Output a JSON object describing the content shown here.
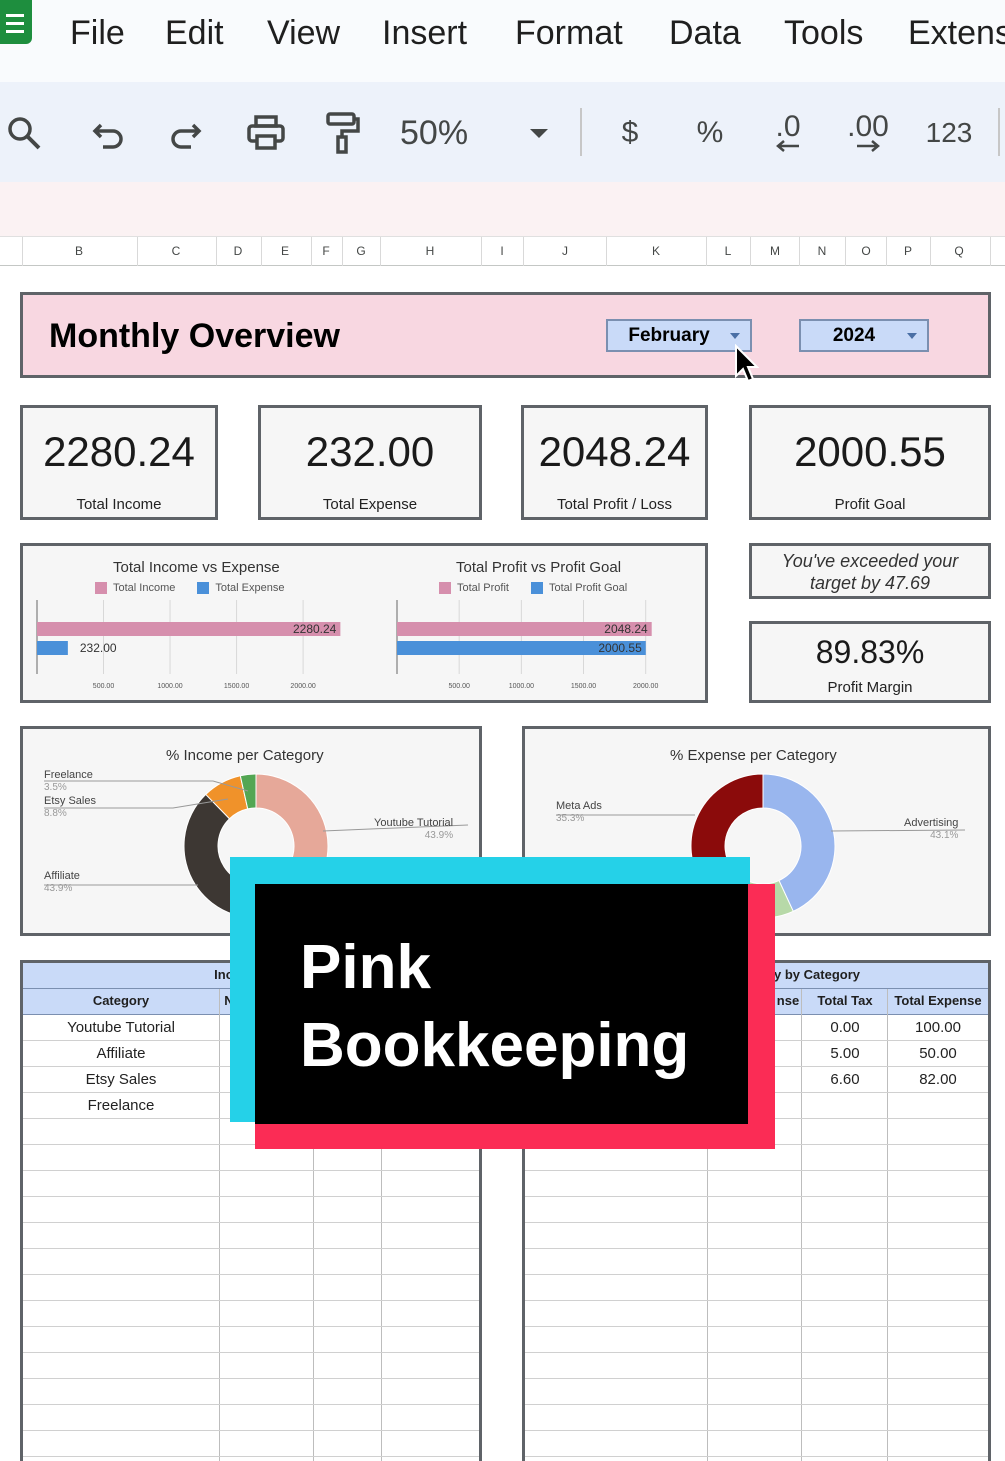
{
  "menu": {
    "items": [
      "File",
      "Edit",
      "View",
      "Insert",
      "Format",
      "Data",
      "Tools",
      "Extens"
    ]
  },
  "toolbar": {
    "zoom": "50%",
    "currency": "$",
    "percent": "%",
    "decrease_decimal": ".0",
    "increase_decimal": ".00",
    "number_format": "123"
  },
  "columns": [
    "B",
    "C",
    "D",
    "E",
    "F",
    "G",
    "H",
    "I",
    "J",
    "K",
    "L",
    "M",
    "N",
    "O",
    "P",
    "Q"
  ],
  "header": {
    "title": "Monthly Overview",
    "month": "February",
    "year": "2024"
  },
  "kpis": [
    {
      "value": "2280.24",
      "label": "Total Income"
    },
    {
      "value": "232.00",
      "label": "Total Expense"
    },
    {
      "value": "2048.24",
      "label": "Total Profit / Loss"
    },
    {
      "value": "2000.55",
      "label": "Profit Goal"
    }
  ],
  "message": {
    "line1": "You've exceeded your",
    "line2": "target by 47.69"
  },
  "profit_margin": {
    "value": "89.83%",
    "label": "Profit Margin"
  },
  "colors": {
    "pink": "#d68fad",
    "blue": "#4a90d9",
    "banner": "#f8d7e1",
    "header_blue": "#c9daf8"
  },
  "chart_data": [
    {
      "type": "bar",
      "title": "Total Income vs Expense",
      "series": [
        {
          "name": "Total Income",
          "values": [
            2280.24
          ]
        },
        {
          "name": "Total Expense",
          "values": [
            232.0
          ]
        }
      ],
      "value_labels": [
        "2280.24",
        "232.00"
      ],
      "xticks": [
        "500.00",
        "1000.00",
        "1500.00",
        "2000.00"
      ],
      "xlim": [
        0,
        2300
      ],
      "legend": "top"
    },
    {
      "type": "bar",
      "title": "Total Profit vs Profit Goal",
      "series": [
        {
          "name": "Total Profit",
          "values": [
            2048.24
          ]
        },
        {
          "name": "Total Profit Goal",
          "values": [
            2000.55
          ]
        }
      ],
      "value_labels": [
        "2048.24",
        "2000.55"
      ],
      "xticks": [
        "500.00",
        "1000.00",
        "1500.00",
        "2000.00"
      ],
      "xlim": [
        0,
        2300
      ],
      "legend": "top"
    },
    {
      "type": "pie",
      "title": "% Income per Category",
      "slices": [
        {
          "name": "Youtube Tutorial",
          "label": "43.9%",
          "value": 43.9,
          "color": "#e6a899"
        },
        {
          "name": "Affiliate",
          "label": "43.9%",
          "value": 43.9,
          "color": "#3d3733"
        },
        {
          "name": "Etsy Sales",
          "label": "8.8%",
          "value": 8.8,
          "color": "#f0922a"
        },
        {
          "name": "Freelance",
          "label": "3.5%",
          "value": 3.5,
          "color": "#53a653"
        }
      ]
    },
    {
      "type": "pie",
      "title": "% Expense per Category",
      "slices": [
        {
          "name": "Advertising",
          "label": "43.1%",
          "value": 43.1,
          "color": "#99b6ee"
        },
        {
          "name": "",
          "label": "",
          "value": 21.6,
          "color": "#b7d9a8"
        },
        {
          "name": "Meta Ads",
          "label": "35.3%",
          "value": 35.3,
          "color": "#8b0b0b"
        }
      ]
    }
  ],
  "income_table": {
    "title": "Income Ove",
    "headers": [
      "Category",
      "N"
    ],
    "rows": [
      "Youtube Tutorial",
      "Affiliate",
      "Etsy Sales",
      "Freelance"
    ]
  },
  "expense_table": {
    "title": "y by Category",
    "headers": [
      "nse",
      "Total Tax",
      "Total Expense"
    ],
    "rows": [
      {
        "tax": "0.00",
        "expense": "100.00"
      },
      {
        "tax": "5.00",
        "expense": "50.00"
      },
      {
        "tax": "6.60",
        "expense": "82.00"
      }
    ]
  },
  "overlay": {
    "line1": "Pink",
    "line2": "Bookkeeping"
  }
}
